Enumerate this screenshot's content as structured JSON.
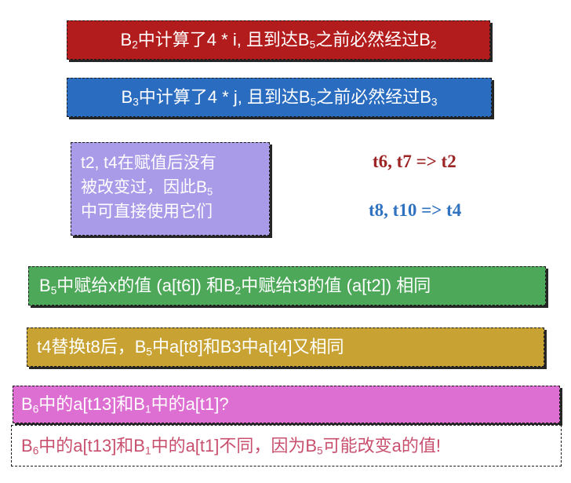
{
  "box1": {
    "pre": "B",
    "sub1": "2",
    "mid": "中计算了4 * i, 且到达B",
    "sub2": "5",
    "mid2": "之前必然经过B",
    "sub3": "2"
  },
  "box2": {
    "pre": "B",
    "sub1": "3",
    "mid": "中计算了4 * j, 且到达B",
    "sub2": "5",
    "mid2": "之前必然经过B",
    "sub3": "3"
  },
  "box3": {
    "line1": "t2, t4在赋值后没有",
    "line2a": "被改变过，因此B",
    "line2_sub": "5",
    "line3": "中可直接使用它们"
  },
  "note1": "t6, t7 => t2",
  "note2": "t8, t10 => t4",
  "box4": {
    "pre": "B",
    "sub1": "5",
    "mid": "中赋给x的值 (a[t6]) 和B",
    "sub2": "2",
    "post": "中赋给t3的值 (a[t2]) 相同"
  },
  "box5": {
    "pre": "t4替换t8后，B",
    "sub1": "5",
    "post": "中a[t8]和B3中a[t4]又相同"
  },
  "box6": {
    "pre": "B",
    "sub1": "6",
    "mid": "中的a[t13]和B",
    "sub2": "1",
    "post": "中的a[t1]?"
  },
  "box7": {
    "pre": "B",
    "sub1": "6",
    "mid": "中的a[t13]和B",
    "sub2": "1",
    "mid2": "中的a[t1]不同，因为B",
    "sub3": "5",
    "post": "可能改变a的值!"
  },
  "colors": {
    "red": "#b31c1c",
    "blue": "#2a6cbf",
    "purple": "#a99be8",
    "green": "#4ea85a",
    "gold": "#c8a333",
    "pink": "#dd6fd2",
    "rose_text": "#c8506e"
  }
}
